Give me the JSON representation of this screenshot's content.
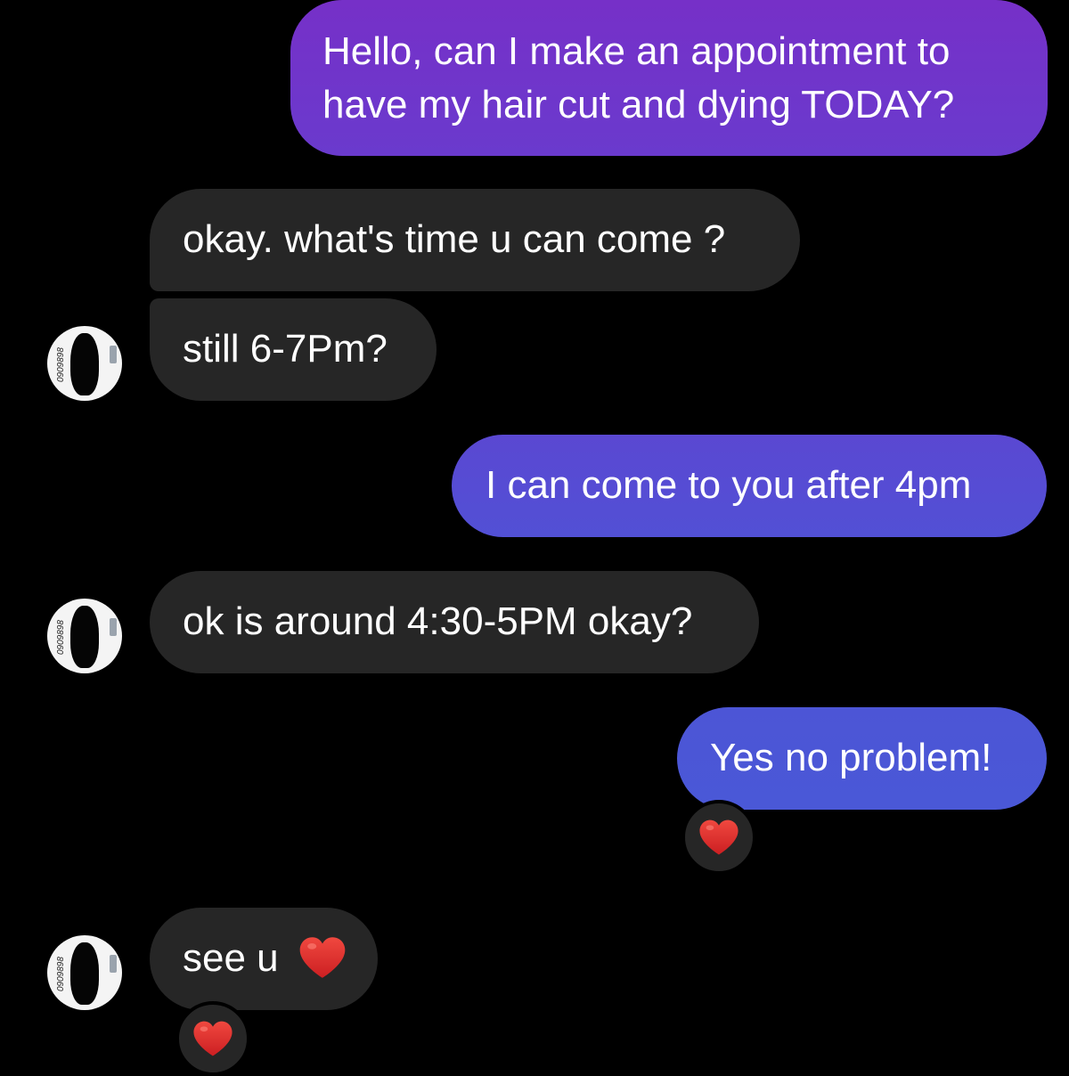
{
  "colors": {
    "background": "#000000",
    "incoming_bubble": "#262626",
    "outgoing_gradient_top": "#7b2fc9",
    "outgoing_gradient_bottom": "#4a57d6",
    "heart": "#e0302f",
    "text": "#ffffff"
  },
  "avatar": {
    "watermark": "0909898"
  },
  "messages": [
    {
      "direction": "outgoing",
      "line1": "Hello, can I make an appointment to",
      "line2": "have my hair cut and dying TODAY?"
    },
    {
      "direction": "incoming",
      "text": "okay. what's time u can come ?"
    },
    {
      "direction": "incoming",
      "text": "still 6-7Pm?"
    },
    {
      "direction": "outgoing",
      "text": "I can come to you after 4pm"
    },
    {
      "direction": "incoming",
      "text": "ok is around 4:30-5PM okay?"
    },
    {
      "direction": "outgoing",
      "text": "Yes no problem!",
      "reaction_icon": "heart-icon"
    },
    {
      "direction": "incoming",
      "text": "see u",
      "inline_icon": "heart-icon",
      "reaction_icon": "heart-icon"
    }
  ]
}
